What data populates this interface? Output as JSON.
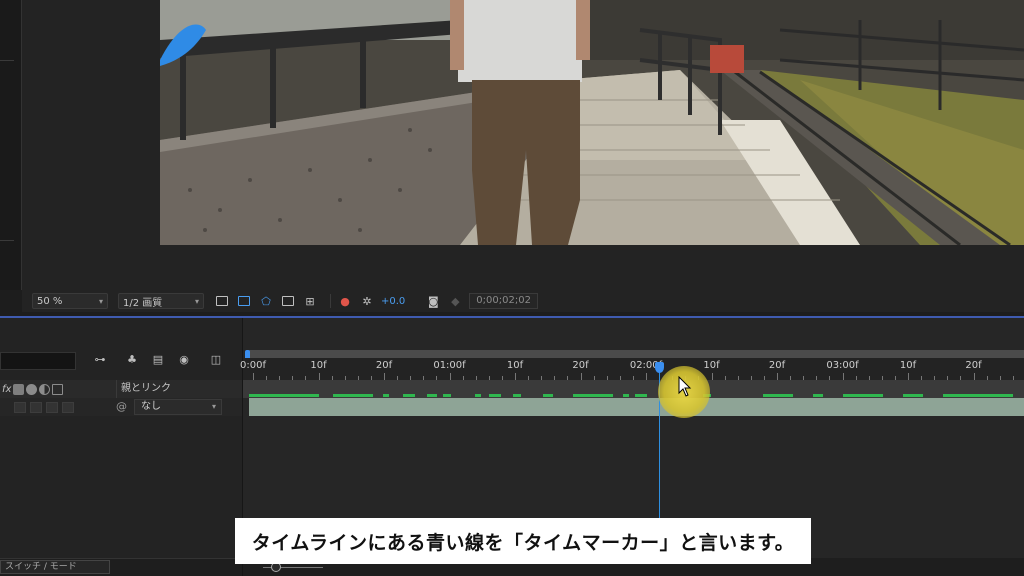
{
  "viewer": {
    "zoom": "50 %",
    "resolution": "1/2 画質",
    "exposure": "+0.0",
    "timecode": "0;00;02;02"
  },
  "timeline": {
    "ruler_labels": [
      {
        "label": "0:00f",
        "frame": 0
      },
      {
        "label": "10f",
        "frame": 10
      },
      {
        "label": "20f",
        "frame": 20
      },
      {
        "label": "01:00f",
        "frame": 30
      },
      {
        "label": "10f",
        "frame": 40
      },
      {
        "label": "20f",
        "frame": 50
      },
      {
        "label": "02:00f",
        "frame": 60
      },
      {
        "label": "10f",
        "frame": 70
      },
      {
        "label": "20f",
        "frame": 80
      },
      {
        "label": "03:00f",
        "frame": 90
      },
      {
        "label": "10f",
        "frame": 100
      },
      {
        "label": "20f",
        "frame": 110
      }
    ],
    "playhead_frame": 62,
    "header": {
      "fx": "fx",
      "parent_link": "親とリンク"
    },
    "layer": {
      "parent_value": "なし"
    },
    "bottom_toggle": "スイッチ / モード"
  },
  "icons": {
    "search": "search-icon",
    "composition_mini": "composition-flowchart-icon",
    "draft3d": "draft-3d-icon",
    "frame_blend": "frame-blending-icon",
    "motion_blur": "motion-blur-icon",
    "graph_editor": "graph-editor-icon",
    "camera": "snapshot-camera-icon",
    "color": "rgb-channels-icon"
  },
  "subtitle": "タイムラインにある青い線を「タイムマーカー」と言います。",
  "colors": {
    "accent_blue": "#3b8ff0",
    "layer_bar": "#8ea496",
    "cache_green": "#2fb84f"
  }
}
